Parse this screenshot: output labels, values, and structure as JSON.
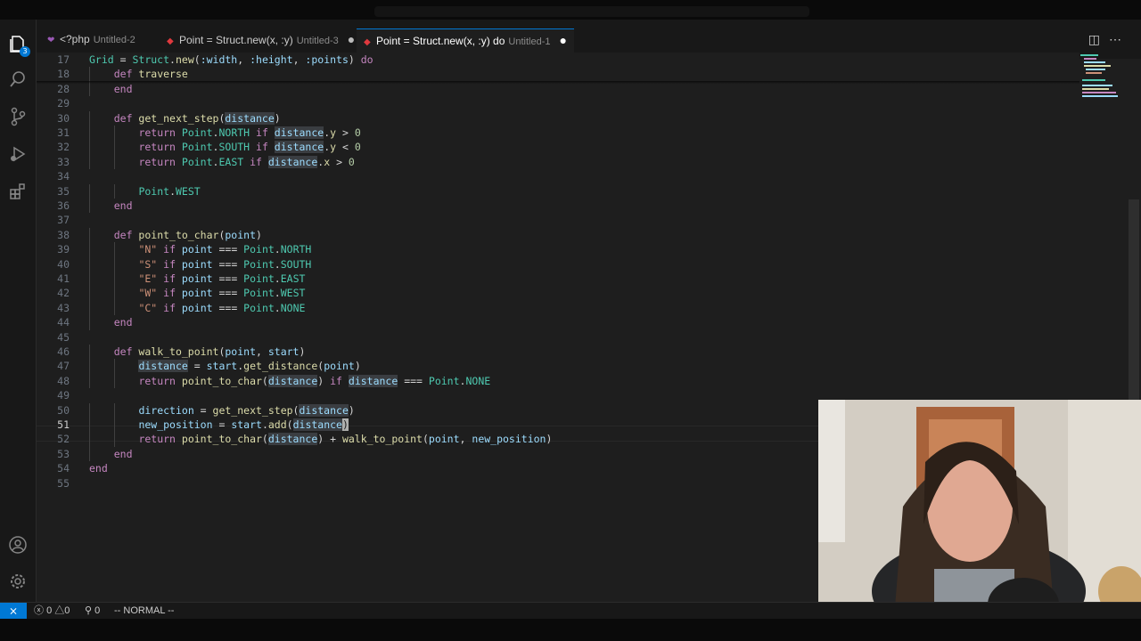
{
  "tabs": [
    {
      "label": "<?php",
      "desc": "Untitled-2",
      "icon": "php-icon",
      "color": "#9b59b6",
      "modified": false
    },
    {
      "label": "Point = Struct.new(x, :y)",
      "desc": "Untitled-3",
      "icon": "ruby-icon",
      "color": "#e0393e",
      "modified": true
    },
    {
      "label": "Point = Struct.new(x, :y) do",
      "desc": "Untitled-1",
      "icon": "ruby-icon",
      "color": "#e0393e",
      "modified": true
    }
  ],
  "activity_bar": {
    "explorer_badge": "3",
    "icons": [
      "files-icon",
      "search-icon",
      "source-control-icon",
      "run-debug-icon",
      "extensions-icon",
      "account-icon",
      "settings-gear-icon"
    ]
  },
  "editor": {
    "current_line": "51",
    "lines": [
      {
        "n": "17",
        "sticky": true,
        "indent": 0,
        "tokens": [
          [
            "ty",
            "Grid"
          ],
          [
            "pl",
            " = "
          ],
          [
            "ty",
            "Struct"
          ],
          [
            "pl",
            "."
          ],
          [
            "fn",
            "new"
          ],
          [
            "pl",
            "("
          ],
          [
            "sym",
            ":width"
          ],
          [
            "pl",
            ", "
          ],
          [
            "sym",
            ":height"
          ],
          [
            "pl",
            ", "
          ],
          [
            "sym",
            ":points"
          ],
          [
            "pl",
            ") "
          ],
          [
            "kw",
            "do"
          ]
        ]
      },
      {
        "n": "18",
        "sticky": true,
        "indent": 1,
        "tokens": [
          [
            "kw",
            "def "
          ],
          [
            "fn",
            "traverse"
          ]
        ]
      },
      {
        "n": "28",
        "indent": 1,
        "tokens": [
          [
            "kw",
            "end"
          ]
        ]
      },
      {
        "n": "29",
        "indent": 0,
        "tokens": []
      },
      {
        "n": "30",
        "indent": 1,
        "tokens": [
          [
            "kw",
            "def "
          ],
          [
            "fn",
            "get_next_step"
          ],
          [
            "pl",
            "("
          ],
          [
            "hl",
            "distance"
          ],
          [
            "pl",
            ")"
          ]
        ]
      },
      {
        "n": "31",
        "indent": 2,
        "tokens": [
          [
            "kw",
            "return "
          ],
          [
            "ty",
            "Point"
          ],
          [
            "pl",
            "."
          ],
          [
            "ty",
            "NORTH"
          ],
          [
            "kw",
            " if "
          ],
          [
            "hl",
            "distance"
          ],
          [
            "pl",
            "."
          ],
          [
            "fn",
            "y"
          ],
          [
            "pl",
            " > "
          ],
          [
            "num",
            "0"
          ]
        ]
      },
      {
        "n": "32",
        "indent": 2,
        "tokens": [
          [
            "kw",
            "return "
          ],
          [
            "ty",
            "Point"
          ],
          [
            "pl",
            "."
          ],
          [
            "ty",
            "SOUTH"
          ],
          [
            "kw",
            " if "
          ],
          [
            "hl",
            "distance"
          ],
          [
            "pl",
            "."
          ],
          [
            "fn",
            "y"
          ],
          [
            "pl",
            " < "
          ],
          [
            "num",
            "0"
          ]
        ]
      },
      {
        "n": "33",
        "indent": 2,
        "tokens": [
          [
            "kw",
            "return "
          ],
          [
            "ty",
            "Point"
          ],
          [
            "pl",
            "."
          ],
          [
            "ty",
            "EAST"
          ],
          [
            "kw",
            " if "
          ],
          [
            "hl",
            "distance"
          ],
          [
            "pl",
            "."
          ],
          [
            "fn",
            "x"
          ],
          [
            "pl",
            " > "
          ],
          [
            "num",
            "0"
          ]
        ]
      },
      {
        "n": "34",
        "indent": 0,
        "tokens": []
      },
      {
        "n": "35",
        "indent": 2,
        "tokens": [
          [
            "ty",
            "Point"
          ],
          [
            "pl",
            "."
          ],
          [
            "ty",
            "WEST"
          ]
        ]
      },
      {
        "n": "36",
        "indent": 1,
        "tokens": [
          [
            "kw",
            "end"
          ]
        ]
      },
      {
        "n": "37",
        "indent": 0,
        "tokens": []
      },
      {
        "n": "38",
        "indent": 1,
        "tokens": [
          [
            "kw",
            "def "
          ],
          [
            "fn",
            "point_to_char"
          ],
          [
            "pl",
            "("
          ],
          [
            "sym",
            "point"
          ],
          [
            "pl",
            ")"
          ]
        ]
      },
      {
        "n": "39",
        "indent": 2,
        "tokens": [
          [
            "str",
            "\"N\""
          ],
          [
            "kw",
            " if "
          ],
          [
            "sym",
            "point"
          ],
          [
            "pl",
            " === "
          ],
          [
            "ty",
            "Point"
          ],
          [
            "pl",
            "."
          ],
          [
            "ty",
            "NORTH"
          ]
        ]
      },
      {
        "n": "40",
        "indent": 2,
        "tokens": [
          [
            "str",
            "\"S\""
          ],
          [
            "kw",
            " if "
          ],
          [
            "sym",
            "point"
          ],
          [
            "pl",
            " === "
          ],
          [
            "ty",
            "Point"
          ],
          [
            "pl",
            "."
          ],
          [
            "ty",
            "SOUTH"
          ]
        ]
      },
      {
        "n": "41",
        "indent": 2,
        "tokens": [
          [
            "str",
            "\"E\""
          ],
          [
            "kw",
            " if "
          ],
          [
            "sym",
            "point"
          ],
          [
            "pl",
            " === "
          ],
          [
            "ty",
            "Point"
          ],
          [
            "pl",
            "."
          ],
          [
            "ty",
            "EAST"
          ]
        ]
      },
      {
        "n": "42",
        "indent": 2,
        "tokens": [
          [
            "str",
            "\"W\""
          ],
          [
            "kw",
            " if "
          ],
          [
            "sym",
            "point"
          ],
          [
            "pl",
            " === "
          ],
          [
            "ty",
            "Point"
          ],
          [
            "pl",
            "."
          ],
          [
            "ty",
            "WEST"
          ]
        ]
      },
      {
        "n": "43",
        "indent": 2,
        "tokens": [
          [
            "str",
            "\"C\""
          ],
          [
            "kw",
            " if "
          ],
          [
            "sym",
            "point"
          ],
          [
            "pl",
            " === "
          ],
          [
            "ty",
            "Point"
          ],
          [
            "pl",
            "."
          ],
          [
            "ty",
            "NONE"
          ]
        ]
      },
      {
        "n": "44",
        "indent": 1,
        "tokens": [
          [
            "kw",
            "end"
          ]
        ]
      },
      {
        "n": "45",
        "indent": 0,
        "tokens": []
      },
      {
        "n": "46",
        "indent": 1,
        "tokens": [
          [
            "kw",
            "def "
          ],
          [
            "fn",
            "walk_to_point"
          ],
          [
            "pl",
            "("
          ],
          [
            "sym",
            "point"
          ],
          [
            "pl",
            ", "
          ],
          [
            "sym",
            "start"
          ],
          [
            "pl",
            ")"
          ]
        ]
      },
      {
        "n": "47",
        "indent": 2,
        "tokens": [
          [
            "hl",
            "distance"
          ],
          [
            "pl",
            " = "
          ],
          [
            "sym",
            "start"
          ],
          [
            "pl",
            "."
          ],
          [
            "fn",
            "get_distance"
          ],
          [
            "pl",
            "("
          ],
          [
            "sym",
            "point"
          ],
          [
            "pl",
            ")"
          ]
        ]
      },
      {
        "n": "48",
        "indent": 2,
        "tokens": [
          [
            "kw",
            "return "
          ],
          [
            "fn",
            "point_to_char"
          ],
          [
            "pl",
            "("
          ],
          [
            "hl",
            "distance"
          ],
          [
            "pl",
            ") "
          ],
          [
            "kw",
            "if "
          ],
          [
            "hl",
            "distance"
          ],
          [
            "pl",
            " === "
          ],
          [
            "ty",
            "Point"
          ],
          [
            "pl",
            "."
          ],
          [
            "ty",
            "NONE"
          ]
        ]
      },
      {
        "n": "49",
        "indent": 0,
        "tokens": []
      },
      {
        "n": "50",
        "indent": 2,
        "tokens": [
          [
            "sym",
            "direction"
          ],
          [
            "pl",
            " = "
          ],
          [
            "fn",
            "get_next_step"
          ],
          [
            "pl",
            "("
          ],
          [
            "hl",
            "distance"
          ],
          [
            "pl",
            ")"
          ]
        ]
      },
      {
        "n": "51",
        "indent": 2,
        "tokens": [
          [
            "sym",
            "new_position"
          ],
          [
            "pl",
            " = "
          ],
          [
            "sym",
            "start"
          ],
          [
            "pl",
            "."
          ],
          [
            "fn",
            "add"
          ],
          [
            "pl",
            "("
          ],
          [
            "hl",
            "distance"
          ],
          [
            "cursor",
            ")"
          ]
        ]
      },
      {
        "n": "52",
        "indent": 2,
        "tokens": [
          [
            "kw",
            "return "
          ],
          [
            "fn",
            "point_to_char"
          ],
          [
            "pl",
            "("
          ],
          [
            "hl",
            "distance"
          ],
          [
            "pl",
            ") + "
          ],
          [
            "fn",
            "walk_to_point"
          ],
          [
            "pl",
            "("
          ],
          [
            "sym",
            "point"
          ],
          [
            "pl",
            ", "
          ],
          [
            "sym",
            "new_position"
          ],
          [
            "pl",
            ")"
          ]
        ]
      },
      {
        "n": "53",
        "indent": 1,
        "tokens": [
          [
            "kw",
            "end"
          ]
        ]
      },
      {
        "n": "54",
        "indent": 0,
        "tokens": [
          [
            "kw",
            "end"
          ]
        ]
      },
      {
        "n": "55",
        "indent": 0,
        "tokens": []
      }
    ]
  },
  "statusbar": {
    "errors": "0",
    "warnings": "0",
    "ports": "0",
    "mode": "-- NORMAL --"
  },
  "colors": {
    "accent": "#0078d4",
    "background": "#1e1e1e"
  }
}
